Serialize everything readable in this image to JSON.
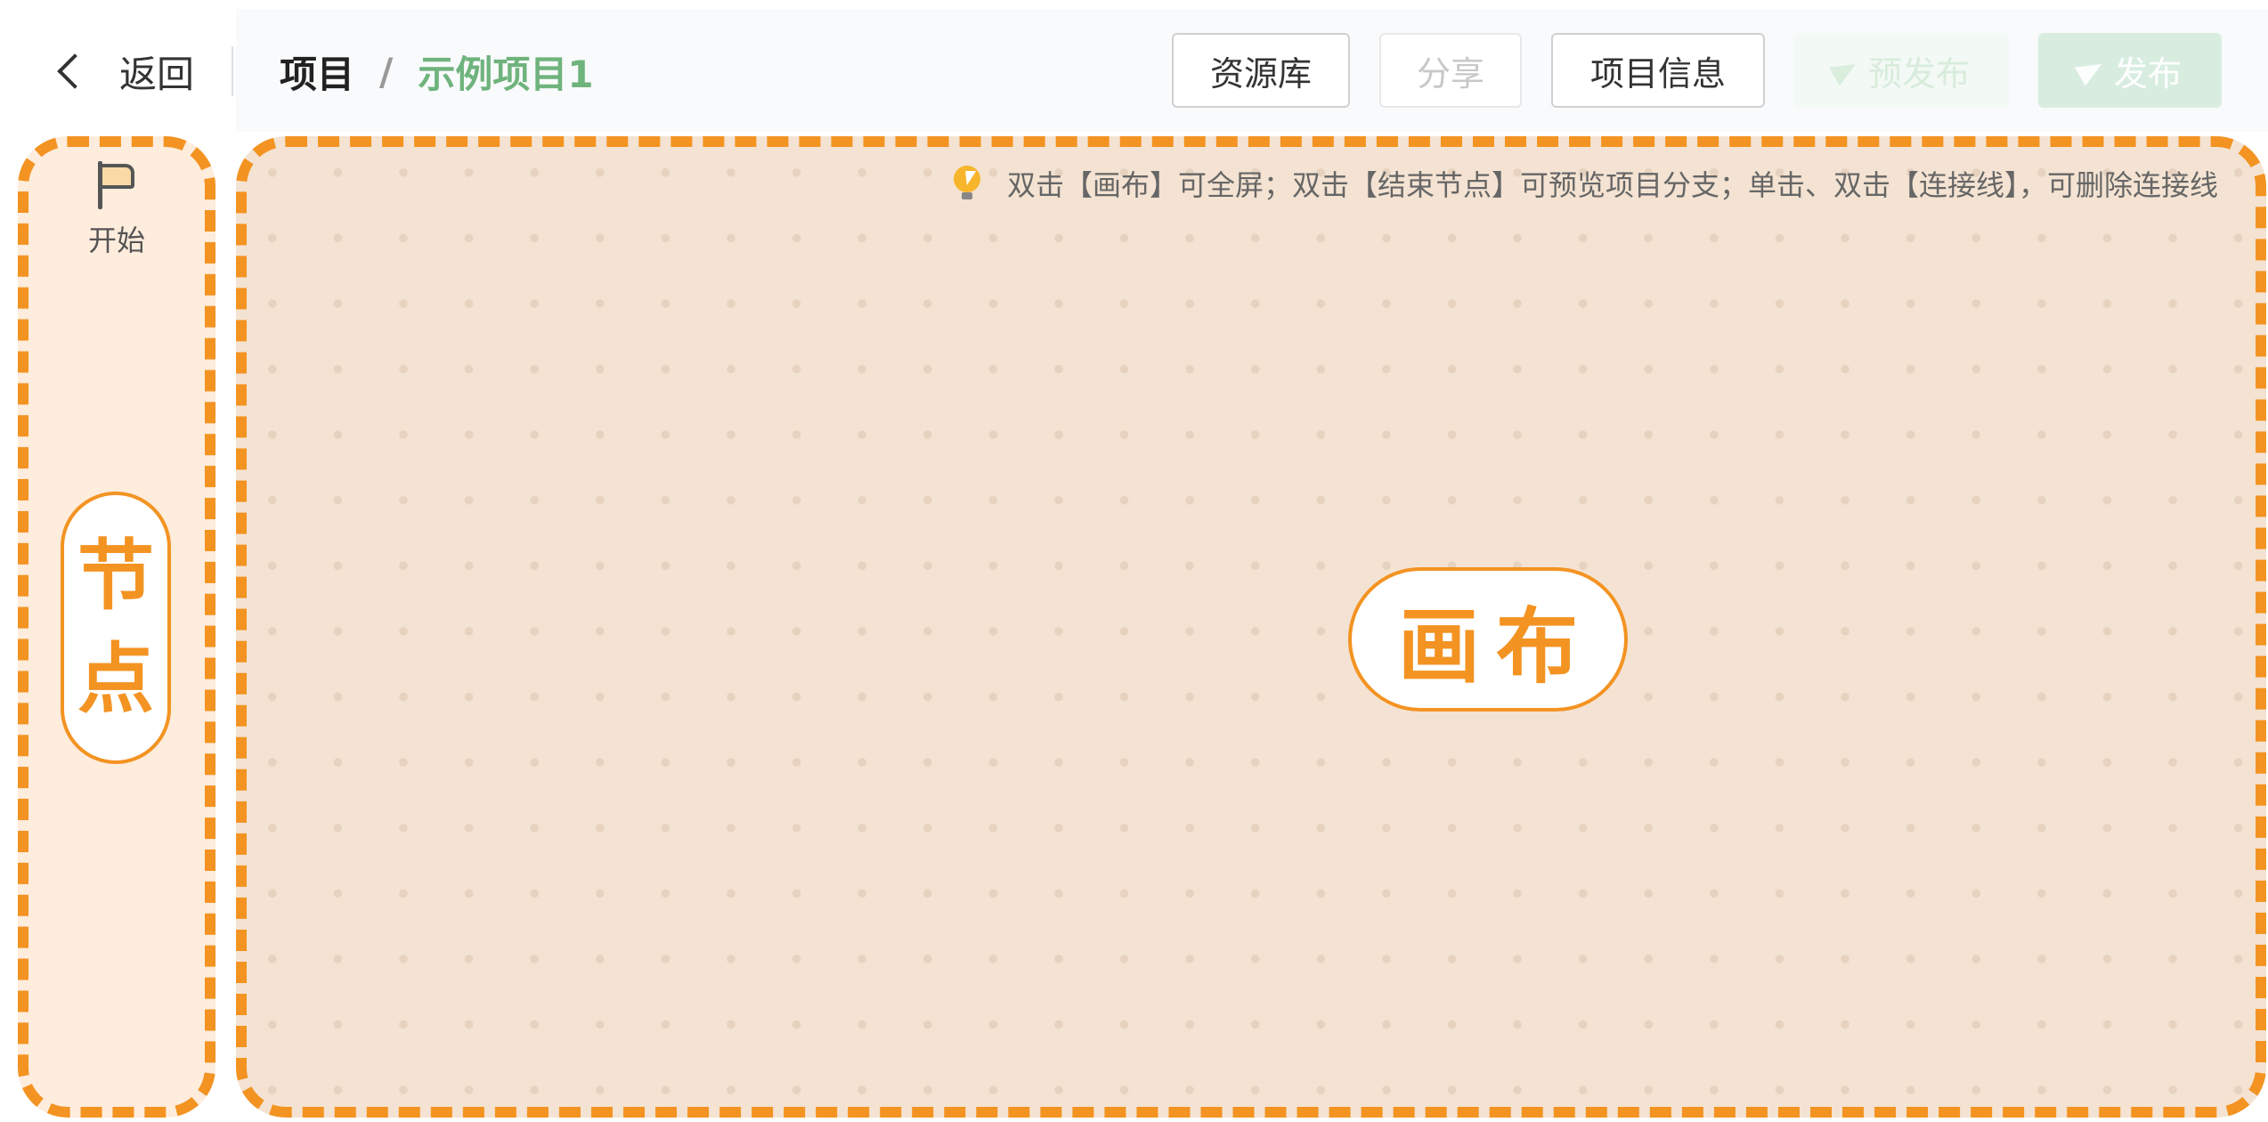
{
  "header": {
    "back_label": "返回",
    "breadcrumb_root": "项目",
    "breadcrumb_sep": "/",
    "breadcrumb_current": "示例项目1",
    "buttons": {
      "library": "资源库",
      "share": "分享",
      "project_info": "项目信息",
      "prepublish": "预发布",
      "publish": "发布"
    }
  },
  "sidebar": {
    "start_label": "开始",
    "label_line1": "节",
    "label_line2": "点"
  },
  "canvas": {
    "tip": "双击【画布】可全屏；双击【结束节点】可预览项目分支；单击、双击【连接线】，可删除连接线",
    "label": "画布"
  },
  "colors": {
    "accent": "#f39322",
    "brand_green": "#6fb37d",
    "canvas_bg": "#f4e3d2",
    "sidebar_bg": "#feecdc"
  },
  "icons": [
    "chevron-left-icon",
    "send-icon",
    "flag-icon",
    "lightbulb-icon"
  ]
}
